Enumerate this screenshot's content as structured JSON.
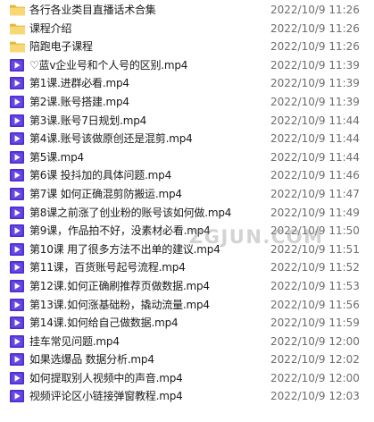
{
  "files": [
    {
      "name": "各行各业类目直播话术合集",
      "date": "2022/10/9 11:26",
      "icon": "folder-icon"
    },
    {
      "name": "课程介绍",
      "date": "2022/10/9 11:26",
      "icon": "folder-icon"
    },
    {
      "name": "陪跑电子课程",
      "date": "2022/10/9 11:26",
      "icon": "folder-icon"
    },
    {
      "name": "♡蓝v企业号和个人号的区别.mp4",
      "date": "2022/10/9 11:39",
      "icon": "video-file-icon"
    },
    {
      "name": "第1课.进群必看.mp4",
      "date": "2022/10/9 11:39",
      "icon": "video-file-icon"
    },
    {
      "name": "第2课.账号搭建.mp4",
      "date": "2022/10/9 11:39",
      "icon": "video-file-icon"
    },
    {
      "name": "第3课.账号7日规划.mp4",
      "date": "2022/10/9 11:44",
      "icon": "video-file-icon"
    },
    {
      "name": "第4课.账号该做原创还是混剪.mp4",
      "date": "2022/10/9 11:44",
      "icon": "video-file-icon"
    },
    {
      "name": "第5课.mp4",
      "date": "2022/10/9 11:44",
      "icon": "video-file-icon"
    },
    {
      "name": "第6课 投抖加的具体问题.mp4",
      "date": "2022/10/9 11:46",
      "icon": "video-file-icon"
    },
    {
      "name": "第7课 如何正确混剪防搬运.mp4",
      "date": "2022/10/9 11:47",
      "icon": "video-file-icon"
    },
    {
      "name": "第8课之前涨了创业粉的账号该如何做.mp4",
      "date": "2022/10/9 11:49",
      "icon": "video-file-icon"
    },
    {
      "name": "第9课，作品拍不好，没素材必看.mp4",
      "date": "2022/10/9 11:50",
      "icon": "video-file-icon"
    },
    {
      "name": "第10课 用了很多方法不出单的建议.mp4",
      "date": "2022/10/9 11:51",
      "icon": "video-file-icon"
    },
    {
      "name": "第11课，百货账号起号流程.mp4",
      "date": "2022/10/9 11:52",
      "icon": "video-file-icon"
    },
    {
      "name": "第12课.如何正确刷推荐页做数据.mp4",
      "date": "2022/10/9 11:53",
      "icon": "video-file-icon"
    },
    {
      "name": "第13课.如何涨基础粉，撬动流量.mp4",
      "date": "2022/10/9 11:56",
      "icon": "video-file-icon"
    },
    {
      "name": "第14课.如何给自己做数据.mp4",
      "date": "2022/10/9 11:59",
      "icon": "video-file-icon"
    },
    {
      "name": "挂车常见问题.mp4",
      "date": "2022/10/9 12:00",
      "icon": "video-file-icon"
    },
    {
      "name": "如果选爆品 数据分析.mp4",
      "date": "2022/10/9 12:02",
      "icon": "video-file-icon"
    },
    {
      "name": "如何提取别人视频中的声音.mp4",
      "date": "2022/10/9 12:00",
      "icon": "video-file-icon"
    },
    {
      "name": "视频评论区小链接弹窗教程.mp4",
      "date": "2022/10/9 12:03",
      "icon": "video-file-icon"
    }
  ],
  "watermark": {
    "text": "ZGJUN.COM"
  },
  "colors": {
    "folder_body": "#f8d775",
    "folder_tab": "#e5b73b",
    "video_icon": "#4b2ccf",
    "date_text": "#6d6d6d"
  }
}
